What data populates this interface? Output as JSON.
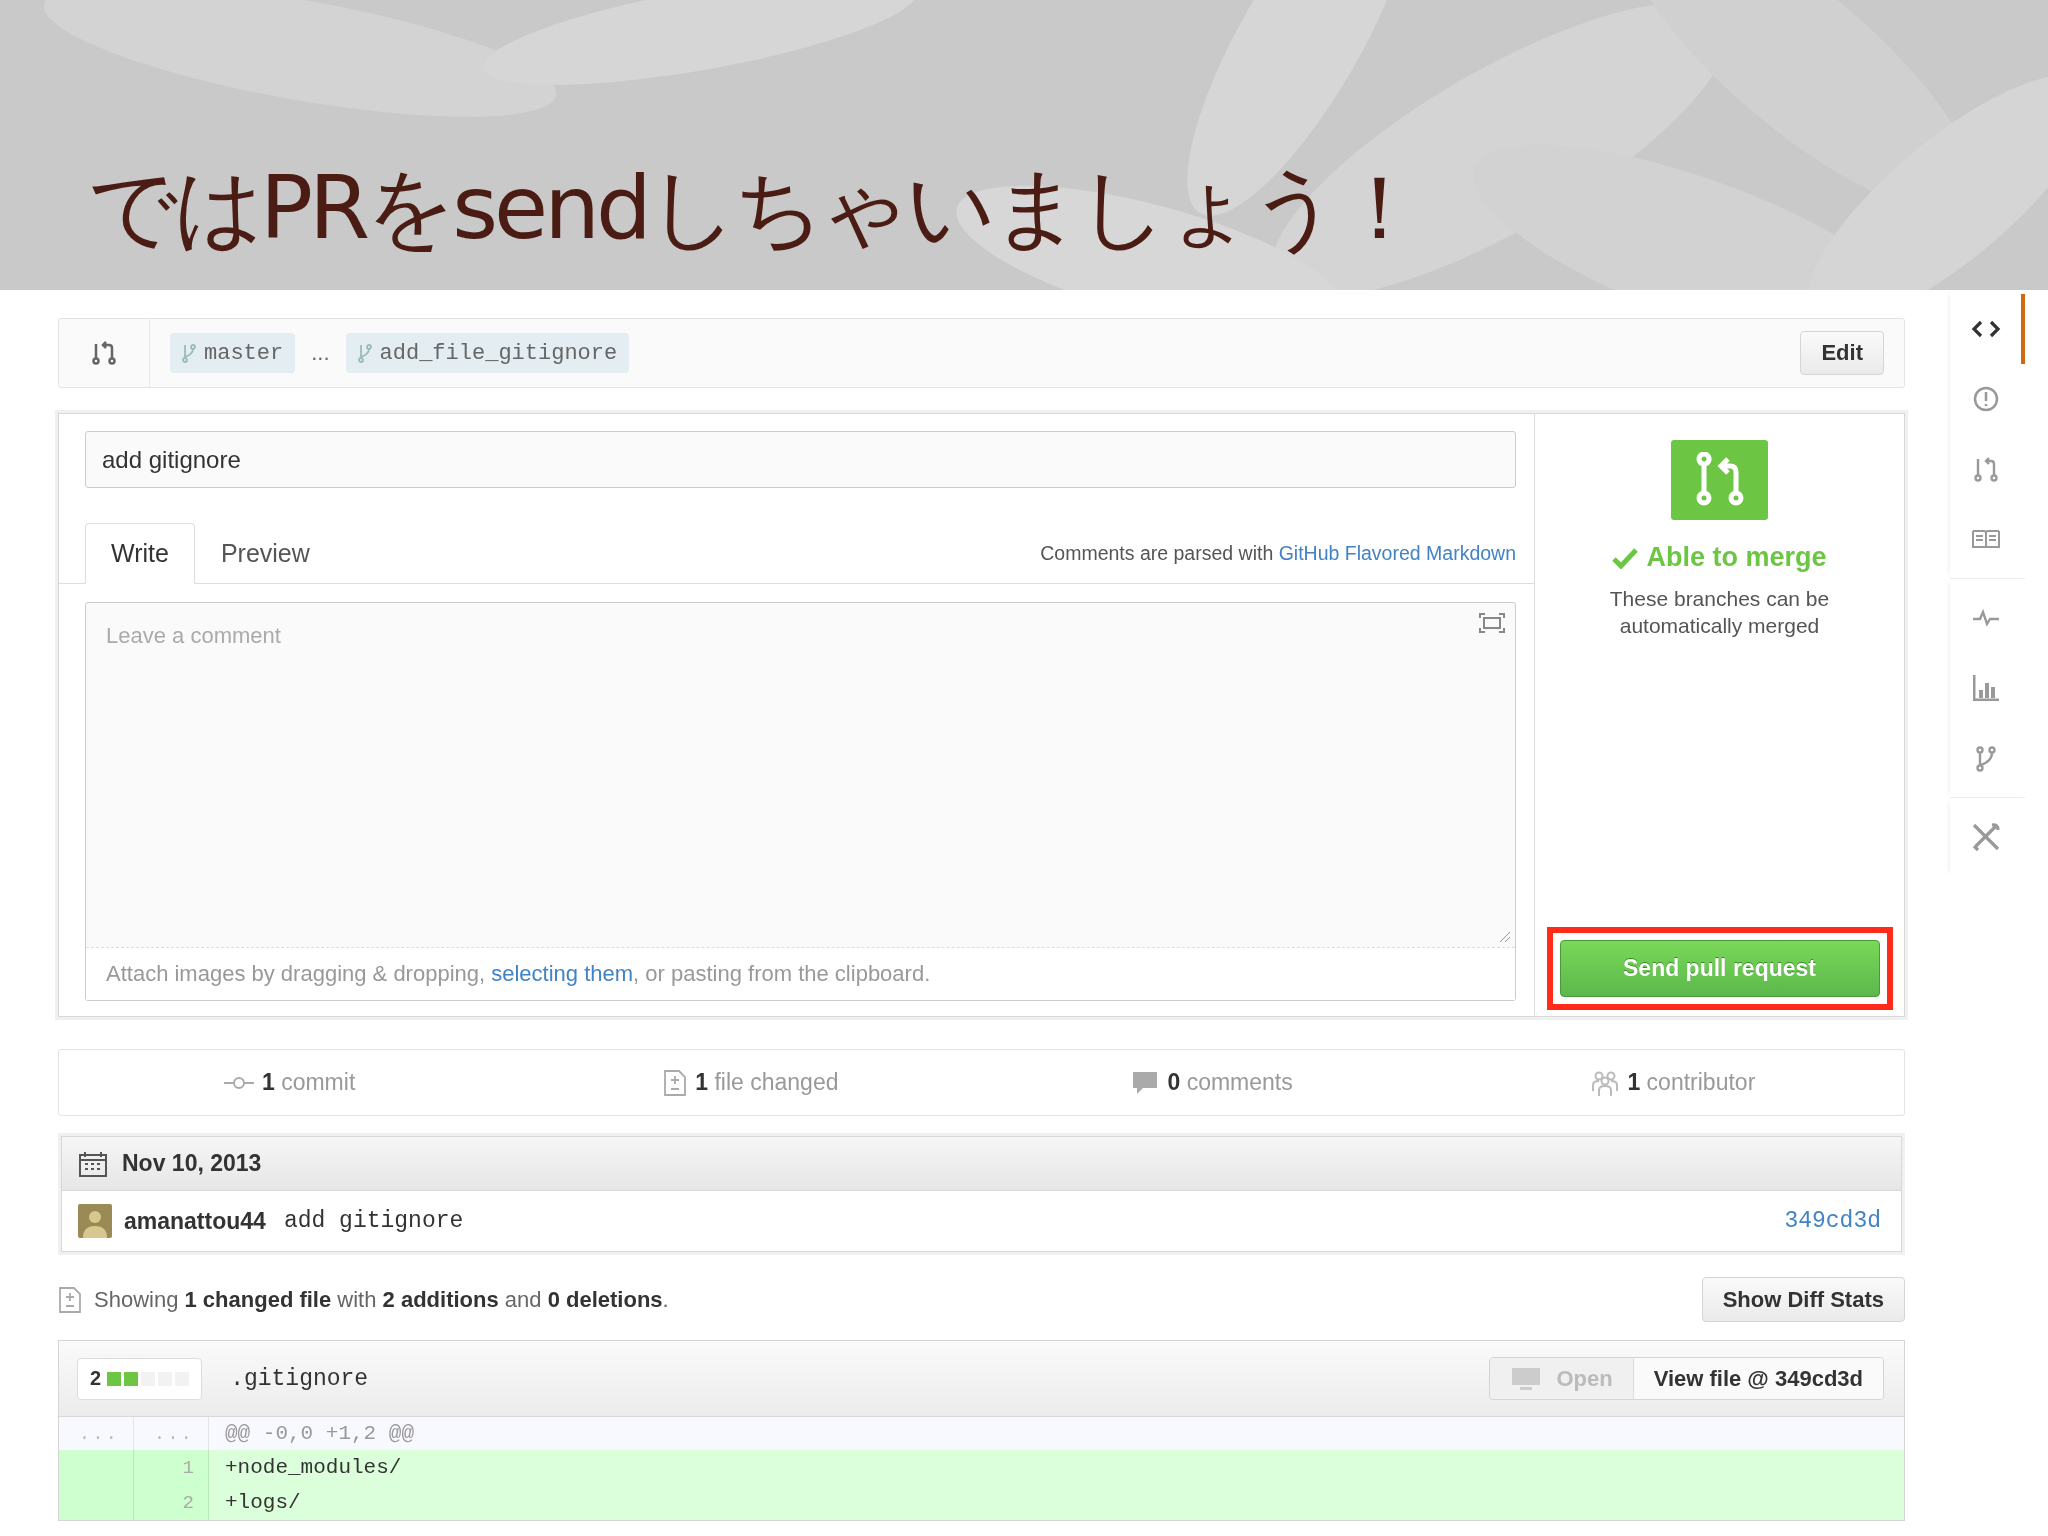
{
  "slide_title": "ではPRをsendしちゃいましょう！",
  "compare": {
    "base": "master",
    "separator": "...",
    "head": "add_file_gitignore",
    "edit_button": "Edit"
  },
  "form": {
    "title_value": "add gitignore",
    "tabs": [
      {
        "label": "Write",
        "selected": true
      },
      {
        "label": "Preview",
        "selected": false
      }
    ],
    "markdown_note": "Comments are parsed with ",
    "markdown_link": "GitHub Flavored Markdown",
    "comment_placeholder": "Leave a comment",
    "attach_before": "Attach images by dragging & dropping, ",
    "attach_link": "selecting them",
    "attach_after": ", or pasting from the clipboard."
  },
  "merge": {
    "status": "Able to merge",
    "description": "These branches can be automatically merged",
    "button": "Send pull request",
    "highlighted": true
  },
  "stats": [
    {
      "kind": "commit",
      "count": "1",
      "label": "commit"
    },
    {
      "kind": "file",
      "count": "1",
      "label": "file changed"
    },
    {
      "kind": "comment",
      "count": "0",
      "label": "comments"
    },
    {
      "kind": "contributor",
      "count": "1",
      "label": "contributor"
    }
  ],
  "commits": {
    "date": "Nov 10, 2013",
    "rows": [
      {
        "author": "amanattou44",
        "message": "add gitignore",
        "sha": "349cd3d"
      }
    ]
  },
  "summary": "Showing **1 changed file** with **2 additions** and **0 deletions**.",
  "show_diff_stats": "Show Diff Stats",
  "files": [
    {
      "additions": "2",
      "level": 0.4,
      "name": ".gitignore",
      "open_button": "Open",
      "open_disabled": true,
      "view_button": "View file @ 349cd3d",
      "lines": [
        {
          "kind": "hunk",
          "old": "...",
          "new": "...",
          "text": "@@ -0,0 +1,2 @@"
        },
        {
          "kind": "add",
          "new": "1",
          "text": "+node_modules/"
        },
        {
          "kind": "add",
          "new": "2",
          "text": "+logs/"
        }
      ]
    }
  ],
  "sidebar": {
    "groups": [
      {
        "items": [
          {
            "kind": "code",
            "selected": true
          },
          {
            "kind": "issues",
            "selected": false
          },
          {
            "kind": "pulls",
            "selected": false
          },
          {
            "kind": "wiki",
            "selected": false
          }
        ]
      },
      {
        "items": [
          {
            "kind": "pulse",
            "selected": false
          },
          {
            "kind": "graphs",
            "selected": false
          },
          {
            "kind": "network",
            "selected": false
          }
        ]
      },
      {
        "items": [
          {
            "kind": "settings",
            "selected": false
          }
        ]
      }
    ]
  }
}
